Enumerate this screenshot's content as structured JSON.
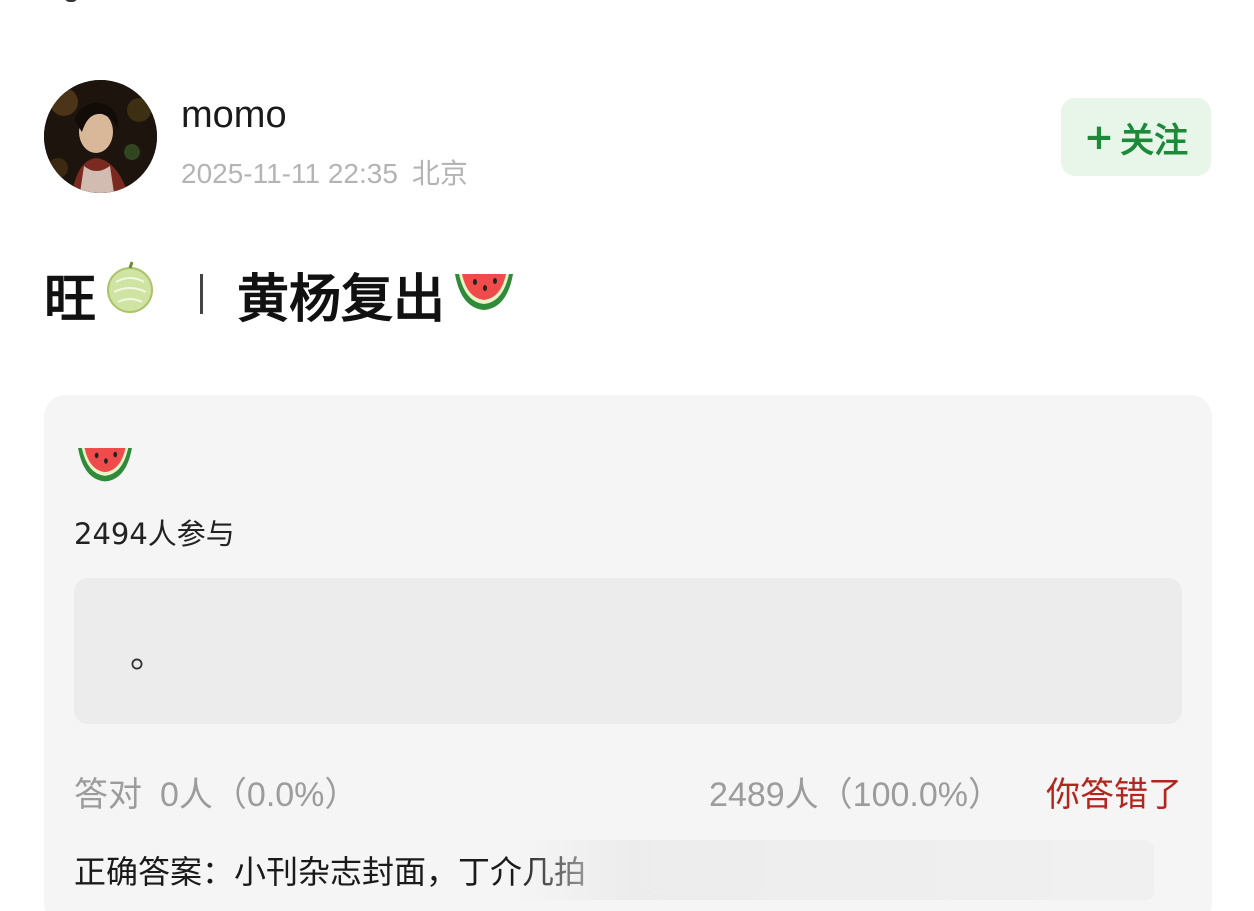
{
  "post": {
    "username": "momo",
    "date": "2025-11-11 22:35",
    "location": "北京",
    "follow_label": "关注",
    "follow_plus": "+",
    "title_prefix": "旺",
    "title_separator": "|",
    "title_main": "黄杨复出"
  },
  "quiz": {
    "participants_text": "2494人参与",
    "answer_text": "。",
    "correct_label": "答对",
    "correct_count": "0人（0.0%）",
    "wrong_count": "2489人（100.0%）",
    "verdict": "你答错了",
    "correct_answer_text": "正确答案：小刊杂志封面，丁介几拍"
  },
  "icons": {
    "title_icon_1": "melon-icon",
    "title_icon_2": "watermelon-icon",
    "quiz_icon": "watermelon-icon"
  },
  "colors": {
    "follow_green": "#1d8a3a",
    "follow_bg": "#e8f6ea",
    "wrong_red": "#b3261e",
    "muted_gray": "#9c9c9c"
  }
}
